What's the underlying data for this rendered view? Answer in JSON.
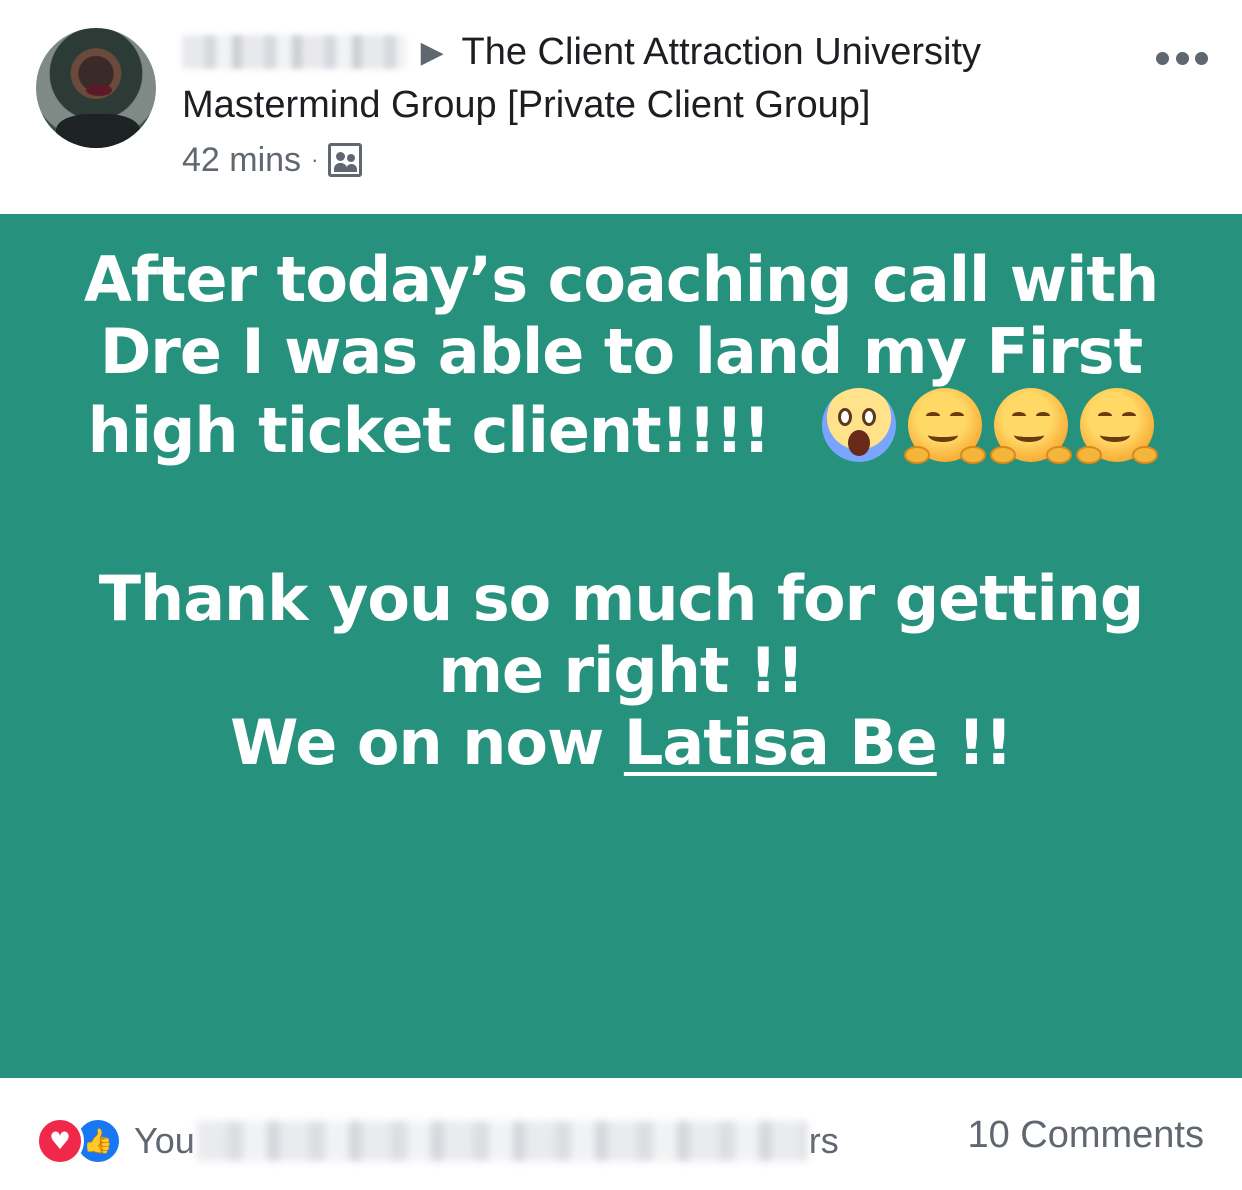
{
  "header": {
    "group_name": "The Client Attraction University Mastermind Group [Private Client Group]",
    "timestamp": "42 mins",
    "separator": "·"
  },
  "post": {
    "line1": "After today’s coaching call with Dre I was able to land my First high ticket client!!!!",
    "line2": "Thank you so much for getting me right !!",
    "line3_prefix": "We on now",
    "mention": "Latisa Be",
    "line3_suffix": "!!",
    "background_color": "#26917c",
    "emojis": [
      "scream-emoji",
      "hugging-emoji",
      "hugging-emoji",
      "hugging-emoji"
    ]
  },
  "footer": {
    "reactions_prefix": "You",
    "reactions_suffix": "rs",
    "comments": "10 Comments",
    "reaction_icons": [
      "love-icon",
      "like-icon"
    ]
  }
}
